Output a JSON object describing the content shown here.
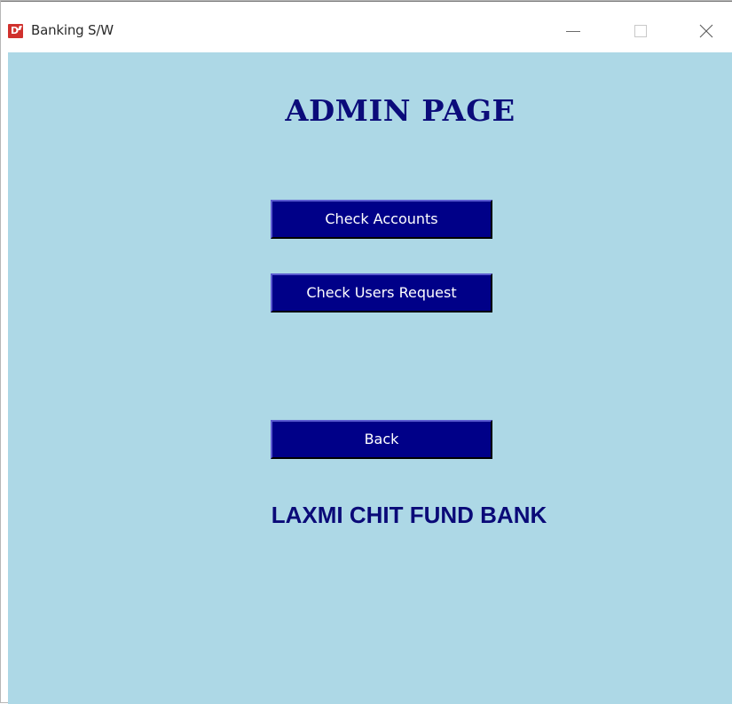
{
  "window": {
    "title": "Banking S/W",
    "icon": "app-logo-icon",
    "controls": [
      "minimize-icon",
      "maximize-icon",
      "close-icon"
    ]
  },
  "page": {
    "heading": "ADMIN PAGE",
    "bank_name": "LAXMI CHIT FUND BANK"
  },
  "buttons": {
    "check_accounts": "Check Accounts",
    "check_users_request": "Check Users Request",
    "back": "Back"
  },
  "colors": {
    "background": "#add8e6",
    "button": "#000088",
    "heading": "#0b0b7a",
    "button_text": "#ffffff"
  }
}
